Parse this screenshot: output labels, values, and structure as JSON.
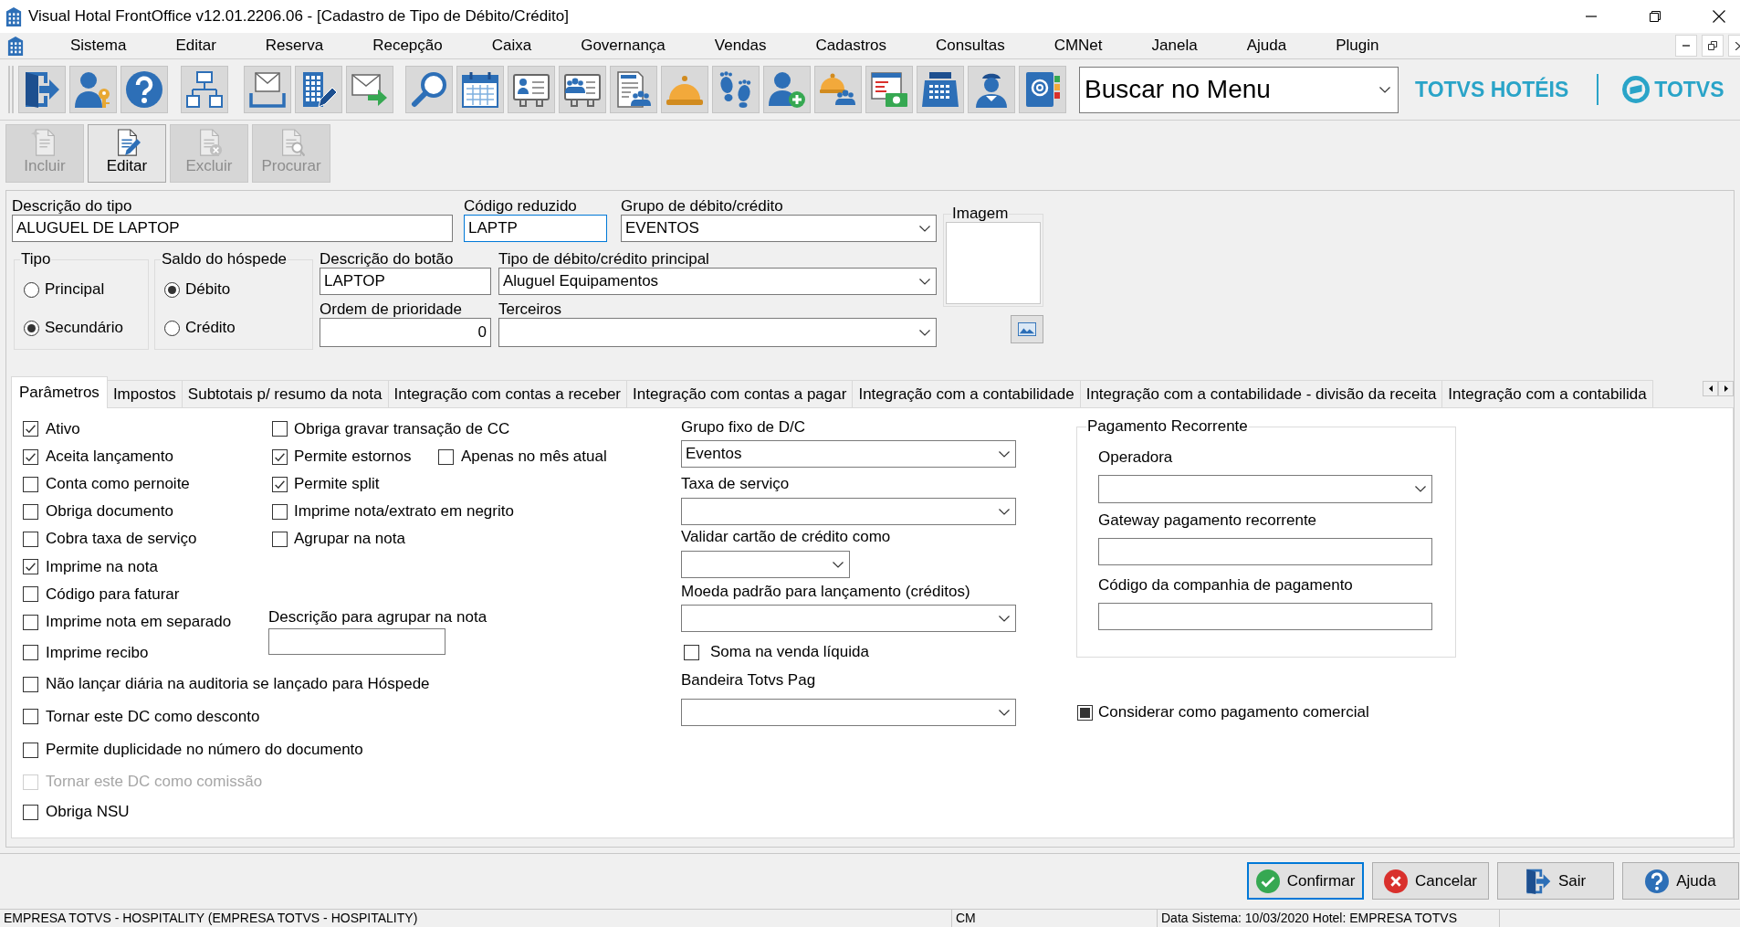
{
  "window": {
    "title": "Visual Hotal FrontOffice v12.01.2206.06 - [Cadastro de Tipo de Débito/Crédito]"
  },
  "menu": [
    "Sistema",
    "Editar",
    "Reserva",
    "Recepção",
    "Caixa",
    "Governança",
    "Vendas",
    "Cadastros",
    "Consultas",
    "CMNet",
    "Janela",
    "Ajuda",
    "Plugin"
  ],
  "toolbar": {
    "menu_search": {
      "value": "Buscar no Menu"
    },
    "brand": {
      "product": "TOTVS HOTÉIS",
      "company": "TOTVS"
    }
  },
  "record_actions": [
    {
      "label": "Incluir",
      "disabled": true
    },
    {
      "label": "Editar",
      "disabled": false
    },
    {
      "label": "Excluir",
      "disabled": true
    },
    {
      "label": "Procurar",
      "disabled": true
    }
  ],
  "form": {
    "descricao_tipo": {
      "label": "Descrição do tipo",
      "value": "ALUGUEL DE LAPTOP",
      "focused": false
    },
    "codigo_reduzido": {
      "label": "Código reduzido",
      "value": "LAPTP",
      "focused": true
    },
    "grupo": {
      "label": "Grupo de débito/crédito",
      "value": "EVENTOS"
    },
    "imagem": {
      "label": "Imagem"
    },
    "tipo": {
      "label": "Tipo",
      "options": [
        {
          "label": "Principal",
          "selected": false
        },
        {
          "label": "Secundário",
          "selected": true
        }
      ]
    },
    "saldo_hospede": {
      "label": "Saldo do hóspede",
      "options": [
        {
          "label": "Débito",
          "selected": true
        },
        {
          "label": "Crédito",
          "selected": false
        }
      ]
    },
    "descricao_botao": {
      "label": "Descrição do botão",
      "value": "LAPTOP",
      "focused": false
    },
    "tipo_principal": {
      "label": "Tipo de débito/crédito principal",
      "value": "Aluguel Equipamentos"
    },
    "ordem_prioridade": {
      "label": "Ordem de prioridade",
      "value": "0",
      "focused": false
    },
    "terceiros": {
      "label": "Terceiros"
    }
  },
  "tabs": [
    {
      "label": "Parâmetros",
      "selected": true
    },
    {
      "label": "Impostos",
      "selected": false
    },
    {
      "label": "Subtotais p/ resumo da nota",
      "selected": false
    },
    {
      "label": "Integração com contas a receber",
      "selected": false
    },
    {
      "label": "Integração com contas a pagar",
      "selected": false
    },
    {
      "label": "Integração com a contabilidade",
      "selected": false
    },
    {
      "label": "Integração com a contabilidade - divisão da receita",
      "selected": false
    },
    {
      "label": "Integração com a contabilida",
      "selected": false
    }
  ],
  "parametros": {
    "checks_left": [
      {
        "label": "Ativo",
        "checked": true,
        "disabled": false
      },
      {
        "label": "Aceita lançamento",
        "checked": true,
        "disabled": false
      },
      {
        "label": "Conta como pernoite",
        "checked": false,
        "disabled": false
      },
      {
        "label": "Obriga documento",
        "checked": false,
        "disabled": false
      },
      {
        "label": "Cobra taxa de serviço",
        "checked": false,
        "disabled": false
      },
      {
        "label": "Imprime na nota",
        "checked": true,
        "disabled": false
      },
      {
        "label": "Código para faturar",
        "checked": false,
        "disabled": false
      },
      {
        "label": "Imprime nota em separado",
        "checked": false,
        "disabled": false
      },
      {
        "label": "Imprime recibo",
        "checked": false,
        "disabled": false
      },
      {
        "label": "Não lançar diária na auditoria se lançado para Hóspede",
        "checked": false,
        "disabled": false
      },
      {
        "label": "Tornar este DC como desconto",
        "checked": false,
        "disabled": false
      },
      {
        "label": "Permite duplicidade no número do documento",
        "checked": false,
        "disabled": false
      },
      {
        "label": "Tornar este DC como comissão",
        "checked": false,
        "disabled": true
      },
      {
        "label": "Obriga NSU",
        "checked": false,
        "disabled": false
      }
    ],
    "checks_middle": [
      {
        "label": "Obriga gravar transação de CC",
        "checked": false
      },
      {
        "label": "Permite estornos",
        "checked": true,
        "sub_option": {
          "label": "Apenas no mês atual",
          "checked": false
        }
      },
      {
        "label": "Permite split",
        "checked": true
      },
      {
        "label": "Imprime nota/extrato em negrito",
        "checked": false
      },
      {
        "label": "Agrupar na nota",
        "checked": false
      }
    ],
    "descricao_agrupar": {
      "label": "Descrição para agrupar na nota"
    },
    "grupo_fixo": {
      "label": "Grupo fixo de D/C",
      "value": "Eventos"
    },
    "taxa_servico": {
      "label": "Taxa de serviço"
    },
    "validar_cartao": {
      "label": "Validar cartão de crédito como"
    },
    "moeda_padrao": {
      "label": "Moeda padrão para lançamento (créditos)"
    },
    "soma_venda_liquida": {
      "label": "Soma na venda líquida",
      "checked": false
    },
    "bandeira": {
      "label": "Bandeira Totvs Pag"
    },
    "pagamento_recorrente": {
      "title": "Pagamento Recorrente",
      "operadora": {
        "label": "Operadora"
      },
      "gateway": {
        "label": "Gateway pagamento recorrente"
      },
      "codigo_companhia": {
        "label": "Código da companhia de pagamento"
      }
    },
    "considerar_pagamento_comercial": {
      "label": "Considerar como pagamento comercial",
      "checked": false,
      "indeterminate": true
    }
  },
  "buttons": [
    {
      "label": "Confirmar",
      "focused": true
    },
    {
      "label": "Cancelar",
      "focused": false
    },
    {
      "label": "Sair",
      "focused": false
    },
    {
      "label": "Ajuda",
      "focused": false
    }
  ],
  "status_bar": [
    "EMPRESA TOTVS - HOSPITALITY (EMPRESA TOTVS - HOSPITALITY)",
    "CM",
    "Data Sistema: 10/03/2020 Hotel: EMPRESA TOTVS"
  ]
}
